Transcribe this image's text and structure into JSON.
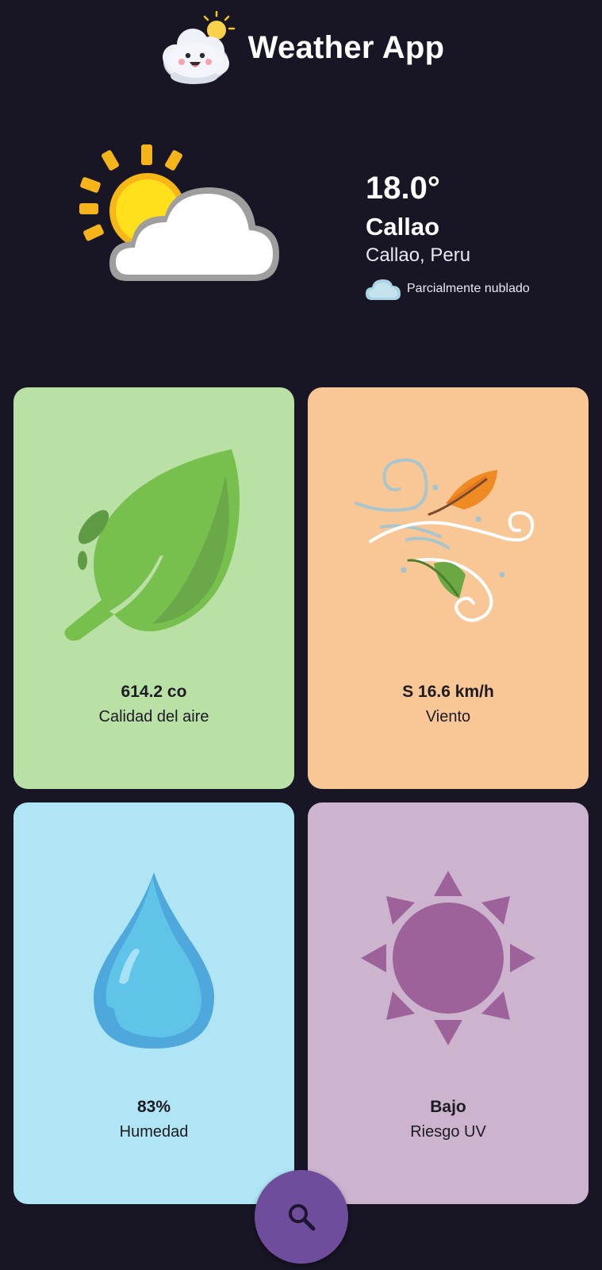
{
  "app": {
    "title": "Weather App"
  },
  "current": {
    "temperature": "18.0°",
    "city": "Callao",
    "region": "Callao, Peru",
    "condition": "Parcialmente nublado"
  },
  "cards": [
    {
      "value": "614.2 co",
      "label": "Calidad del aire",
      "icon": "leaf-icon",
      "color": "#b9e0a5"
    },
    {
      "value": "S 16.6 km/h",
      "label": "Viento",
      "icon": "wind-icon",
      "color": "#f8c795"
    },
    {
      "value": "83%",
      "label": "Humedad",
      "icon": "water-drop-icon",
      "color": "#afe5f4"
    },
    {
      "value": "Bajo",
      "label": "Riesgo UV",
      "icon": "sun-icon",
      "color": "#ccb4ce"
    }
  ],
  "colors": {
    "background": "#181524",
    "fab": "#6e4e9c"
  },
  "search_button": {
    "icon": "search-icon"
  }
}
